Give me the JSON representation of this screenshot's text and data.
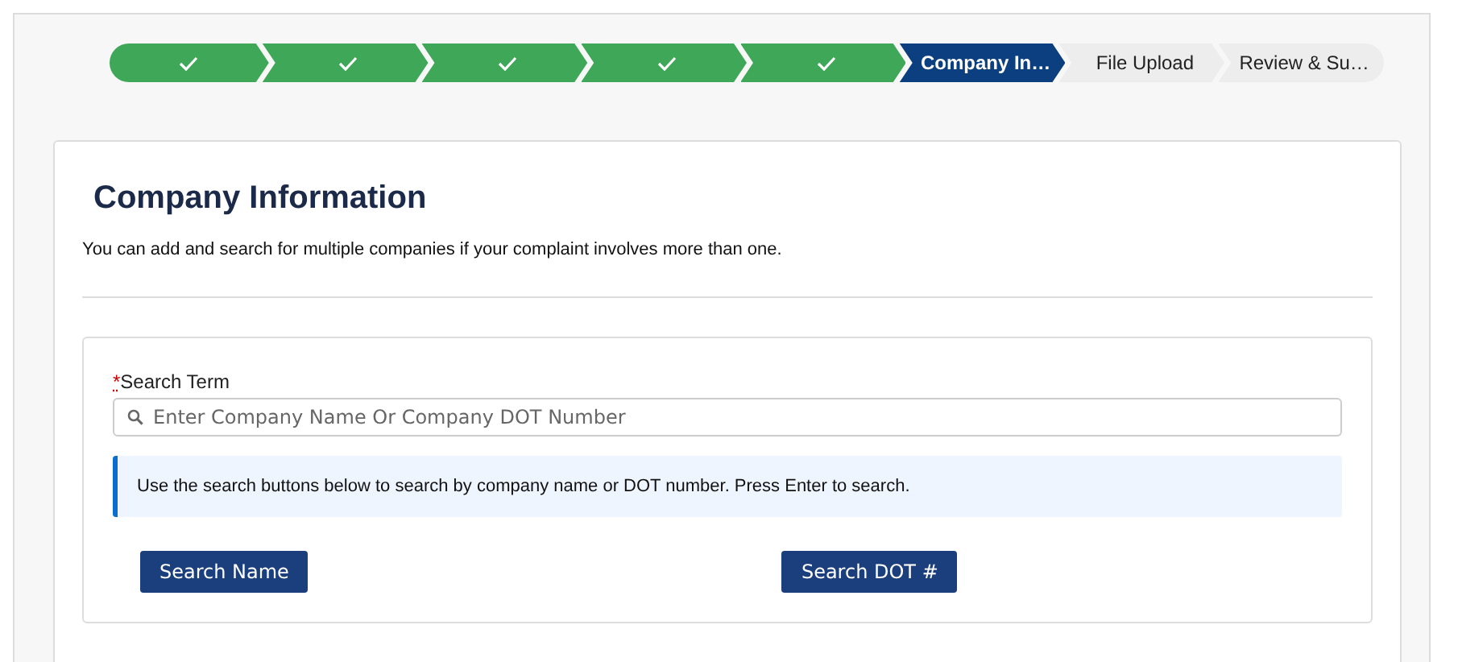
{
  "steps": [
    {
      "kind": "complete"
    },
    {
      "kind": "complete"
    },
    {
      "kind": "complete"
    },
    {
      "kind": "complete"
    },
    {
      "kind": "complete"
    },
    {
      "kind": "current",
      "label": "Company In…"
    },
    {
      "kind": "upcoming",
      "label": "File Upload"
    },
    {
      "kind": "upcoming",
      "label": "Review & Su…"
    }
  ],
  "heading": "Company Information",
  "intro": "You can add and search for multiple companies if your complaint involves more than one.",
  "search": {
    "required_mark": "*",
    "label": "Search Term",
    "placeholder": "Enter Company Name Or Company DOT Number"
  },
  "info": "Use the search buttons below to search by company name or DOT number. Press Enter to search.",
  "buttons": [
    "Search Name",
    "Search DOT #"
  ]
}
